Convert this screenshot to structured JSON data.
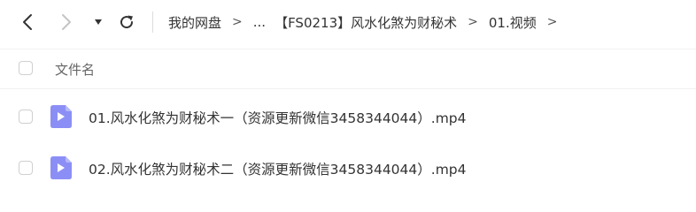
{
  "toolbar": {
    "back_icon": "chevron-left-icon",
    "forward_icon": "chevron-right-icon",
    "dropdown_icon": "caret-down-icon",
    "refresh_icon": "refresh-icon"
  },
  "breadcrumb": {
    "root": "我的网盘",
    "separator": ">",
    "ellipsis": "...",
    "folder": "【FS0213】风水化煞为财秘术",
    "current": "01.视频"
  },
  "file_list": {
    "header": "文件名",
    "files": [
      {
        "name": "01.风水化煞为财秘术一（资源更新微信3458344044）.mp4",
        "icon": "video-file-icon"
      },
      {
        "name": "02.风水化煞为财秘术二（资源更新微信3458344044）.mp4",
        "icon": "video-file-icon"
      }
    ]
  },
  "colors": {
    "video_icon": "#8b8ff5",
    "video_icon_fold": "#b5b8fa"
  }
}
